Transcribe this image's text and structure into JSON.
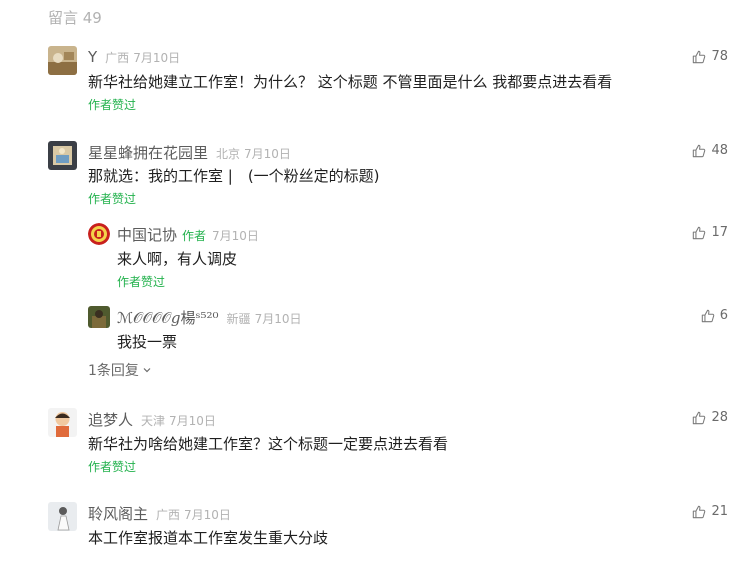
{
  "header": {
    "title": "留言 49"
  },
  "comments": [
    {
      "nick": "Y",
      "location": "广西",
      "time": "7月10日",
      "text": "新华社给她建立工作室！为什么？ 这个标题 不管里面是什么 我都要点进去看看",
      "praised": "作者赞过",
      "likes": "78"
    },
    {
      "nick": "星星蜂拥在花园里",
      "location": "北京",
      "time": "7月10日",
      "text": "那就选：我的工作室 |　(一个粉丝定的标题)",
      "praised": "作者赞过",
      "likes": "48"
    },
    {
      "nick": "追梦人",
      "location": "天津",
      "time": "7月10日",
      "text": "新华社为啥给她建工作室？这个标题一定要点进去看看",
      "praised": "作者赞过",
      "likes": "28"
    },
    {
      "nick": "聆风阁主",
      "location": "广西",
      "time": "7月10日",
      "text": "本工作室报道本工作室发生重大分歧",
      "likes": "21"
    }
  ],
  "replies": [
    {
      "nick": "中国记协",
      "author_tag": "作者",
      "time": "7月10日",
      "text": "来人啊，有人调皮",
      "praised": "作者赞过",
      "likes": "17"
    },
    {
      "nick": "ℳ𝒪𝒪𝒪𝒪𝑔楊ˢ⁵²⁰",
      "location": "新疆",
      "time": "7月10日",
      "text": "我投一票",
      "likes": "6"
    }
  ],
  "reply_toggle": {
    "label": "1条回复"
  },
  "colors": {
    "green": "#22b14c",
    "grey_meta": "#b2b2b2",
    "nick": "#5c5c5c"
  }
}
